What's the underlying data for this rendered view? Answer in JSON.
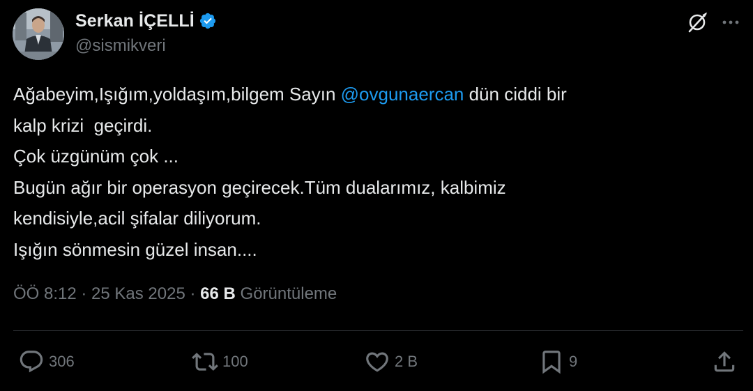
{
  "author": {
    "display_name": "Serkan İÇELLİ",
    "handle": "@sismikveri",
    "verified_color": "#1d9bf0"
  },
  "tweet": {
    "line1_before": "Ağabeyim,Işığım,yoldaşım,bilgem Sayın ",
    "mention": "@ovgunaercan",
    "line1_after": " dün ciddi bir",
    "line2": "kalp krizi  geçirdi.",
    "line3": "Çok üzgünüm çok ...",
    "line4": "Bugün ağır bir operasyon geçirecek.Tüm dualarımız, kalbimiz",
    "line5": "kendisiyle,acil şifalar diliyorum.",
    "line6": "Işığın sönmesin güzel insan...."
  },
  "meta": {
    "time": "ÖÖ 8:12",
    "sep1": " · ",
    "date": "25 Kas 2025",
    "sep2": " · ",
    "views_count": "66 B",
    "views_label": " Görüntüleme"
  },
  "actions": {
    "replies": "306",
    "reposts": "100",
    "likes": "2 B",
    "bookmarks": "9"
  },
  "icons": {
    "grok": "grok-icon",
    "more": "more-icon",
    "reply": "reply-icon",
    "repost": "repost-icon",
    "like": "heart-icon",
    "bookmark": "bookmark-icon",
    "share": "share-icon",
    "verified": "verified-badge-icon"
  },
  "colors": {
    "background": "#000000",
    "text_primary": "#e7e9ea",
    "text_secondary": "#71767b",
    "accent": "#1d9bf0",
    "divider": "#2f3336"
  }
}
